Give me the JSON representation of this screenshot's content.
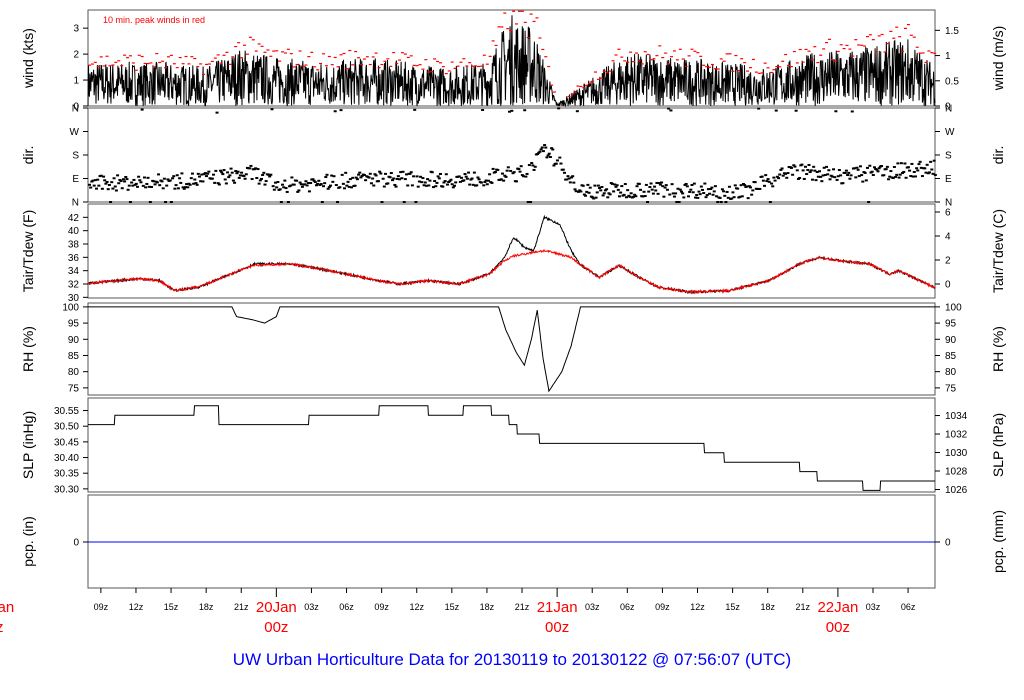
{
  "chart_data": [
    {
      "type": "line",
      "id": "wind",
      "ylabel": "wind (kts)",
      "ylabel_right": "wind (m/s)",
      "ylim": [
        0,
        3.7
      ],
      "yticks": [
        0,
        1,
        2,
        3
      ],
      "yticks_right": [
        {
          "v": 0,
          "label": "0"
        },
        {
          "v": 0.5,
          "label": "0.5"
        },
        {
          "v": 1,
          "label": "1"
        },
        {
          "v": 1.5,
          "label": "1.5"
        }
      ],
      "annotation": "10 min. peak winds in red",
      "series": [
        {
          "name": "wind",
          "color": "#000000"
        },
        {
          "name": "peak",
          "color": "#ff0000"
        }
      ],
      "envelope": {
        "t": [
          -16,
          -10,
          -6,
          -3,
          0,
          4,
          8,
          14,
          18,
          20,
          22,
          24,
          27,
          30,
          34,
          38,
          42,
          46,
          50,
          54,
          56
        ],
        "kts": [
          0.9,
          0.9,
          0.8,
          1.2,
          1.0,
          0.9,
          1.0,
          0.8,
          0.9,
          1.9,
          1.6,
          0.05,
          0.6,
          1.1,
          1.0,
          0.9,
          0.8,
          1.1,
          1.2,
          1.4,
          0.9
        ]
      }
    },
    {
      "type": "scatter",
      "id": "dir",
      "ylabel": "dir.",
      "yticks": [
        {
          "v": 0,
          "label": "N"
        },
        {
          "v": 90,
          "label": "E"
        },
        {
          "v": 180,
          "label": "S"
        },
        {
          "v": 270,
          "label": "W"
        },
        {
          "v": 360,
          "label": "N"
        }
      ],
      "ylim": [
        0,
        360
      ],
      "trend": {
        "t": [
          -16,
          -8,
          -2,
          0,
          8,
          16,
          21,
          23,
          26,
          32,
          40,
          44,
          48,
          56
        ],
        "deg": [
          70,
          80,
          110,
          60,
          90,
          85,
          110,
          200,
          40,
          50,
          40,
          120,
          100,
          130
        ]
      }
    },
    {
      "type": "line",
      "id": "temp",
      "ylabel": "Tair/Tdew (F)",
      "ylabel_right": "Tair/Tdew (C)",
      "ylim": [
        29.9,
        44
      ],
      "yticks": [
        30,
        32,
        34,
        36,
        38,
        40,
        42
      ],
      "yticks_right": [
        {
          "v": 32,
          "label": "0"
        },
        {
          "v": 35.6,
          "label": "2"
        },
        {
          "v": 39.2,
          "label": "4"
        },
        {
          "v": 42.8,
          "label": "6"
        }
      ],
      "series": [
        {
          "name": "Tair",
          "color": "#000000",
          "t": [
            -16.1,
            -11.7,
            -10,
            -8.7,
            -6.5,
            -3.2,
            -1.9,
            1.1,
            3.7,
            8.8,
            10.5,
            13,
            15.6,
            18.2,
            19.5,
            20.3,
            21.2,
            22,
            22.9,
            24.2,
            25.2,
            25.9,
            27.6,
            29.3,
            31,
            32.7,
            35.3,
            38.7,
            42.1,
            44.7,
            46.4,
            48.1,
            50.7,
            52.4,
            53.2,
            56.2
          ],
          "v": [
            32.1,
            32.8,
            32.5,
            31,
            31.6,
            34,
            35,
            35,
            34.3,
            32.5,
            32,
            32.5,
            32,
            33.5,
            36,
            39,
            37.5,
            37,
            42,
            41,
            37,
            35,
            33,
            34.8,
            33,
            31.5,
            30.8,
            31,
            32.5,
            35,
            36,
            35.5,
            35,
            33.5,
            34,
            31.5
          ]
        },
        {
          "name": "Tdew",
          "color": "#ff0000",
          "t": [
            -16.1,
            -11.7,
            -10,
            -8.7,
            -6.5,
            -3.2,
            -1.9,
            1.1,
            3.7,
            8.8,
            10.5,
            13,
            15.6,
            18.2,
            19.5,
            20.3,
            21.2,
            22,
            22.9,
            24.2,
            25.2,
            25.9,
            27.6,
            29.3,
            31,
            32.7,
            35.3,
            38.7,
            42.1,
            44.7,
            46.4,
            48.1,
            50.7,
            52.4,
            53.2,
            56.2
          ],
          "v": [
            32.1,
            32.8,
            32.5,
            31,
            31.6,
            34,
            34.8,
            35,
            34.3,
            32.5,
            32,
            32.5,
            32,
            33.5,
            35.5,
            36.2,
            36.5,
            36.8,
            37,
            36.5,
            36,
            35,
            33,
            34.8,
            33,
            31.5,
            30.8,
            31,
            32.5,
            35,
            36,
            35.5,
            35,
            33.5,
            34,
            31.5
          ]
        }
      ]
    },
    {
      "type": "line",
      "id": "rh",
      "ylabel": "RH (%)",
      "ylabel_right": "RH (%)",
      "ylim": [
        72.8,
        101.2
      ],
      "yticks": [
        75,
        80,
        85,
        90,
        95,
        100
      ],
      "series": [
        {
          "name": "RH",
          "color": "#000000",
          "t": [
            -16.1,
            -3.8,
            -3.4,
            -2,
            -1,
            0,
            0.3,
            19,
            19.6,
            20.5,
            21.2,
            21.8,
            22.3,
            22.8,
            23.3,
            24.4,
            25.2,
            26,
            56.2
          ],
          "v": [
            100,
            100,
            97,
            96,
            95,
            97,
            100,
            100,
            93,
            86,
            82,
            90,
            99,
            84,
            74,
            80,
            88,
            100,
            100
          ]
        }
      ]
    },
    {
      "type": "line",
      "id": "slp",
      "ylabel": "SLP (inHg)",
      "ylabel_right": "SLP (hPa)",
      "ylim": [
        30.29,
        30.59
      ],
      "yticks": [
        30.3,
        30.35,
        30.4,
        30.45,
        30.5,
        30.55
      ],
      "yticks_right": [
        {
          "v": 30.298,
          "label": "1026"
        },
        {
          "v": 30.357,
          "label": "1028"
        },
        {
          "v": 30.416,
          "label": "1030"
        },
        {
          "v": 30.475,
          "label": "1032"
        },
        {
          "v": 30.534,
          "label": "1034"
        }
      ],
      "series": [
        {
          "name": "SLP",
          "color": "#000000",
          "t": [
            -16.1,
            -13.8,
            -10.4,
            -7,
            -4.9,
            2.8,
            8.8,
            13,
            16,
            18.4,
            19.9,
            20.6,
            22.5,
            36.6,
            38.3,
            44.7,
            46.2,
            50.1,
            51.6,
            56.2
          ],
          "v": [
            30.505,
            30.535,
            30.535,
            30.565,
            30.505,
            30.535,
            30.565,
            30.535,
            30.565,
            30.535,
            30.505,
            30.475,
            30.445,
            30.415,
            30.385,
            30.355,
            30.325,
            30.295,
            30.325,
            30.325
          ]
        }
      ]
    },
    {
      "type": "line",
      "id": "pcp",
      "ylabel": "pcp. (in)",
      "ylabel_right": "pcp. (mm)",
      "yticks": [
        {
          "v": 0,
          "label": "0"
        }
      ],
      "yticks_right": [
        {
          "v": 0,
          "label": "0"
        }
      ],
      "series": [
        {
          "name": "pcp",
          "color": "#0000ff",
          "value": 0
        }
      ]
    }
  ],
  "x_axis": {
    "ticks": [
      {
        "t": -15,
        "label": "09z"
      },
      {
        "t": -12,
        "label": "12z"
      },
      {
        "t": -9,
        "label": "15z"
      },
      {
        "t": -6,
        "label": "18z"
      },
      {
        "t": -3,
        "label": "21z"
      },
      {
        "t": 0,
        "label": "20Jan",
        "label2": "00z",
        "day": true
      },
      {
        "t": 3,
        "label": "03z"
      },
      {
        "t": 6,
        "label": "06z"
      },
      {
        "t": 9,
        "label": "09z"
      },
      {
        "t": 12,
        "label": "12z"
      },
      {
        "t": 15,
        "label": "15z"
      },
      {
        "t": 18,
        "label": "18z"
      },
      {
        "t": 21,
        "label": "21z"
      },
      {
        "t": 24,
        "label": "21Jan",
        "label2": "00z",
        "day": true
      },
      {
        "t": 27,
        "label": "03z"
      },
      {
        "t": 30,
        "label": "06z"
      },
      {
        "t": 33,
        "label": "09z"
      },
      {
        "t": 36,
        "label": "12z"
      },
      {
        "t": 39,
        "label": "15z"
      },
      {
        "t": 42,
        "label": "18z"
      },
      {
        "t": 45,
        "label": "21z"
      },
      {
        "t": 48,
        "label": "22Jan",
        "label2": "00z",
        "day": true
      },
      {
        "t": 51,
        "label": "03z"
      },
      {
        "t": 54,
        "label": "06z"
      }
    ],
    "clipped_left": {
      "label": "Jan",
      "label2": "z"
    },
    "range": [
      -16.1,
      56.3
    ]
  },
  "title": "UW Urban Horticulture Data for 20130119  to  20130122 @ 07:56:07  (UTC)"
}
